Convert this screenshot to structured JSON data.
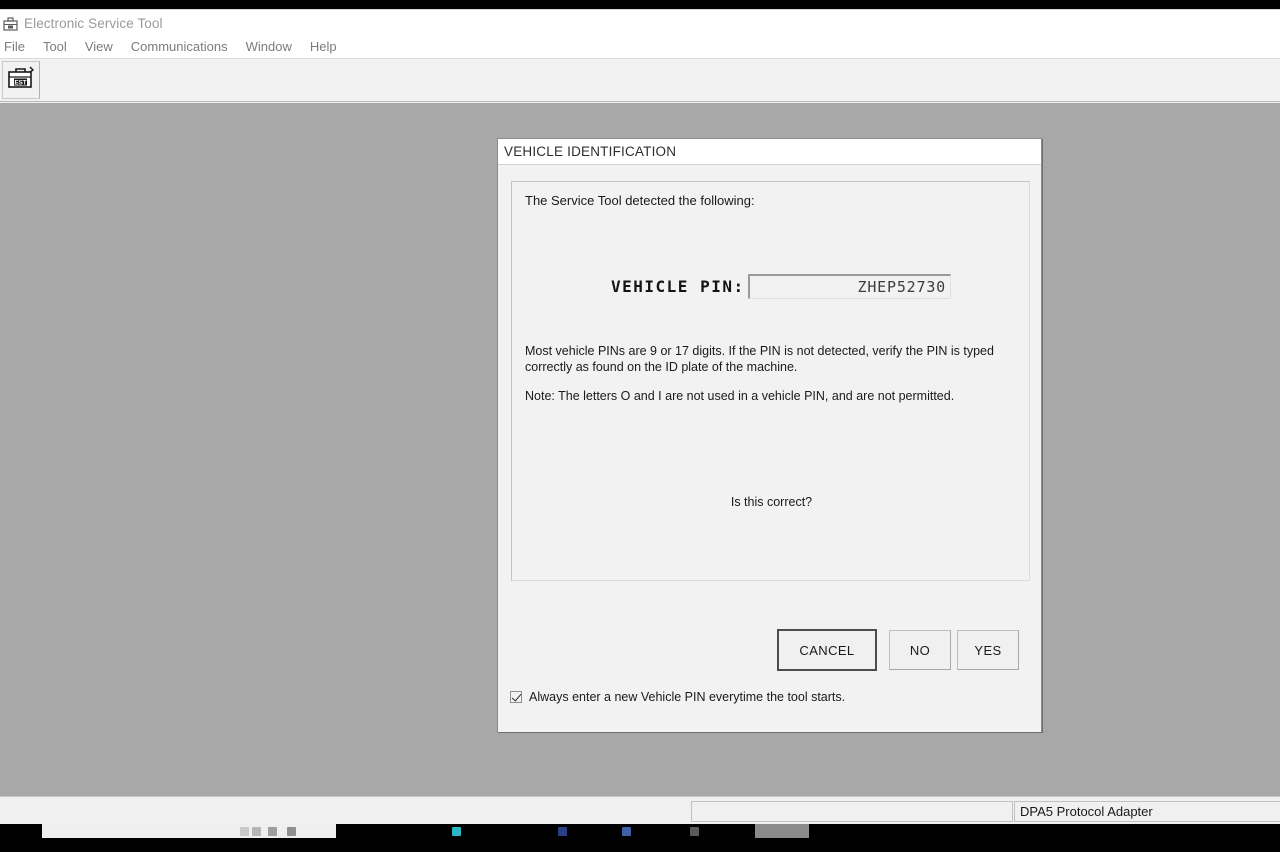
{
  "window": {
    "title": "Electronic Service Tool",
    "title_icon": "toolbox-icon",
    "menu": [
      {
        "label": "File"
      },
      {
        "label": "Tool"
      },
      {
        "label": "View"
      },
      {
        "label": "Communications"
      },
      {
        "label": "Window"
      },
      {
        "label": "Help"
      }
    ],
    "toolbar": {
      "est_button_icon": "est-toolbox-icon",
      "est_button_label": "EST"
    },
    "statusbar": {
      "left_panel_text": "",
      "right_panel_text": "DPA5 Protocol Adapter"
    }
  },
  "dialog": {
    "title": "VEHICLE IDENTIFICATION",
    "detected_label": "The Service Tool detected the following:",
    "pin_label": "VEHICLE PIN:",
    "pin_value": "ZHEP52730",
    "pin_placeholder": "",
    "paragraph_1": "Most vehicle PINs are 9 or 17 digits. If the PIN is not detected, verify the PIN is typed correctly as found on the ID plate of the machine.",
    "paragraph_2": "Note: The letters O and I are not used in a vehicle PIN, and are not permitted.",
    "confirm_question": "Is this correct?",
    "buttons": {
      "cancel": "CANCEL",
      "no": "NO",
      "yes": "YES"
    },
    "checkbox": {
      "label": "Always enter a new Vehicle PIN everytime the tool starts.",
      "checked": "true"
    }
  },
  "colors": {
    "client_background": "#a8a8a8",
    "dialog_background": "#f2f2f2",
    "window_chrome": "#f0f0f0",
    "text_primary": "#1a1a1a",
    "title_text": "#9a9a9a",
    "menu_text": "#7c7c7c",
    "taskbar": "#000000"
  }
}
